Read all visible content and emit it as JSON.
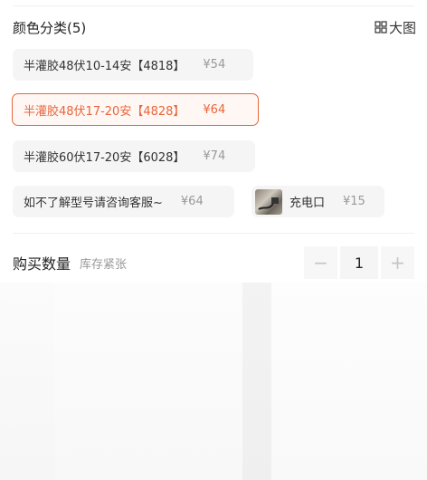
{
  "section": {
    "title": "颜色分类(5)",
    "big_image_label": "大图"
  },
  "options": [
    {
      "label": "半灌胶48伏10-14安【4818】",
      "price": "¥54"
    },
    {
      "label": "半灌胶48伏17-20安【4828】",
      "price": "¥64",
      "selected": true
    },
    {
      "label": "半灌胶60伏17-20安【6028】",
      "price": "¥74"
    },
    {
      "label": "如不了解型号请咨询客服~",
      "price": "¥64"
    },
    {
      "label": "充电口",
      "price": "¥15"
    }
  ],
  "quantity": {
    "label": "购买数量",
    "stock_note": "库存紧张",
    "value": "1",
    "minus": "−",
    "plus": "+"
  },
  "colors": {
    "accent": "#e8663c",
    "option_bg": "#f5f5f5"
  },
  "icons": [
    "grid-icon",
    "connector-thumbnail"
  ]
}
